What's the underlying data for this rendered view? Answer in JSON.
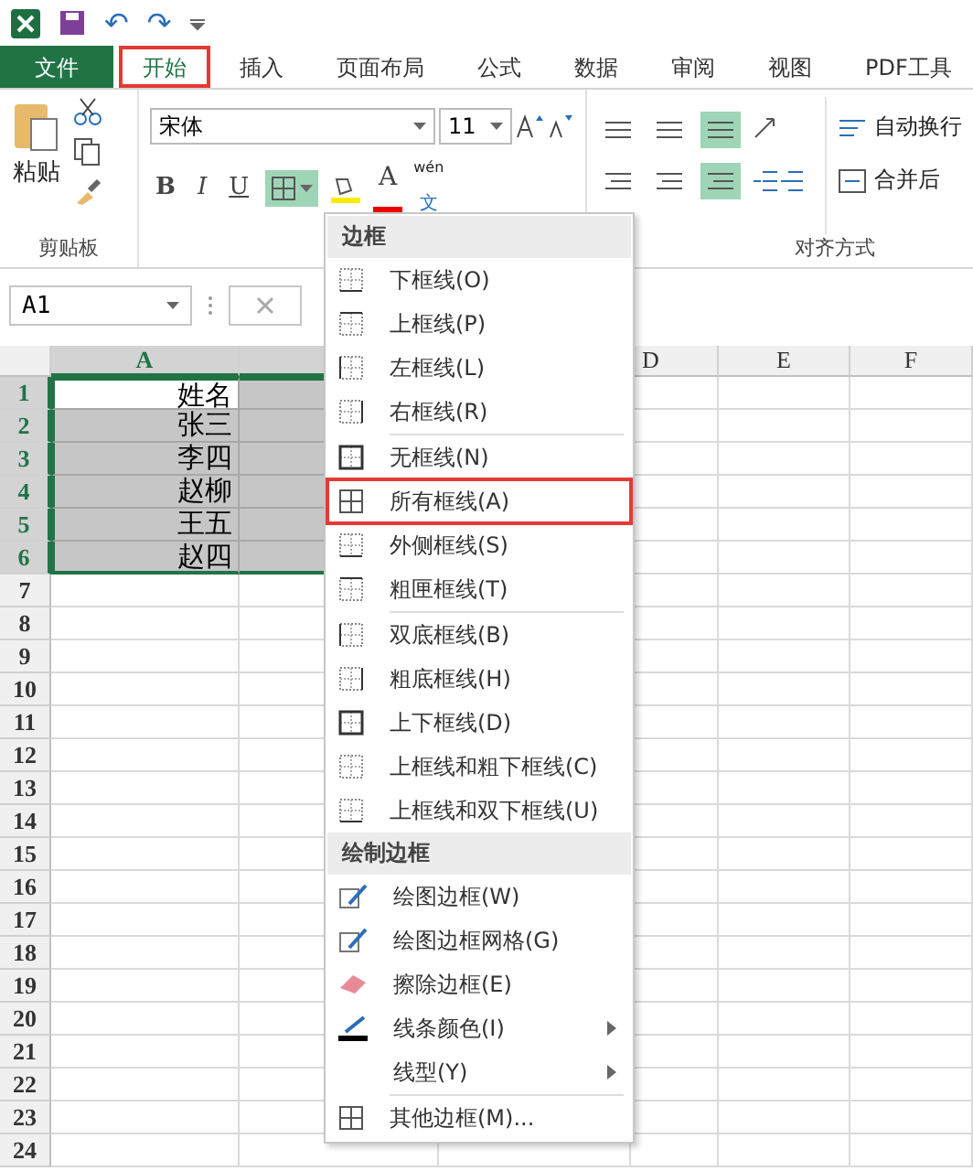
{
  "quick_access": {
    "undo": "↶",
    "redo": "↷"
  },
  "tabs": [
    {
      "label": "文件",
      "kind": "file",
      "selected": false,
      "highlighted": false
    },
    {
      "label": "开始",
      "kind": "tab",
      "selected": true,
      "highlighted": true
    },
    {
      "label": "插入",
      "kind": "tab",
      "selected": false,
      "highlighted": false
    },
    {
      "label": "页面布局",
      "kind": "tab",
      "selected": false,
      "highlighted": false
    },
    {
      "label": "公式",
      "kind": "tab",
      "selected": false,
      "highlighted": false
    },
    {
      "label": "数据",
      "kind": "tab",
      "selected": false,
      "highlighted": false
    },
    {
      "label": "审阅",
      "kind": "tab",
      "selected": false,
      "highlighted": false
    },
    {
      "label": "视图",
      "kind": "tab",
      "selected": false,
      "highlighted": false
    },
    {
      "label": "PDF工具",
      "kind": "tab",
      "selected": false,
      "highlighted": false
    }
  ],
  "ribbon": {
    "paste": "粘贴",
    "clipboard_group": "剪贴板",
    "font_name": "宋体",
    "font_size": "11",
    "bold": "B",
    "italic": "I",
    "underline": "U",
    "font_color_letter": "A",
    "phonetic_top": "wén",
    "phonetic_bottom": "文",
    "wrap_text": "自动换行",
    "merge": "合并后",
    "alignment_group": "对齐方式"
  },
  "formula_bar": {
    "name_box": "A1"
  },
  "sheet": {
    "columns": [
      {
        "label": "A",
        "selected": true
      },
      {
        "label": "D",
        "selected": false
      },
      {
        "label": "E",
        "selected": false
      },
      {
        "label": "F",
        "selected": false
      }
    ],
    "rows": [
      "1",
      "2",
      "3",
      "4",
      "5",
      "6",
      "7",
      "8",
      "9",
      "10",
      "11",
      "12",
      "13",
      "14",
      "15",
      "16",
      "17",
      "18",
      "19",
      "20",
      "21",
      "22",
      "23",
      "24"
    ],
    "cells": [
      {
        "text": "姓名",
        "active": true
      },
      {
        "text": "张三",
        "active": false
      },
      {
        "text": "李四",
        "active": false
      },
      {
        "text": "赵柳",
        "active": false
      },
      {
        "text": "王五",
        "active": false
      },
      {
        "text": "赵四",
        "active": false
      }
    ]
  },
  "border_menu": {
    "items": [
      {
        "kind": "header",
        "label": "边框"
      },
      {
        "kind": "item",
        "label": "下框线(O)",
        "highlighted": false
      },
      {
        "kind": "item",
        "label": "上框线(P)",
        "highlighted": false
      },
      {
        "kind": "item",
        "label": "左框线(L)",
        "highlighted": false
      },
      {
        "kind": "item",
        "label": "右框线(R)",
        "highlighted": false
      },
      {
        "kind": "divider"
      },
      {
        "kind": "item",
        "label": "无框线(N)",
        "highlighted": false
      },
      {
        "kind": "item",
        "label": "所有框线(A)",
        "highlighted": true
      },
      {
        "kind": "item",
        "label": "外侧框线(S)",
        "highlighted": false
      },
      {
        "kind": "item",
        "label": "粗匣框线(T)",
        "highlighted": false
      },
      {
        "kind": "divider"
      },
      {
        "kind": "item",
        "label": "双底框线(B)",
        "highlighted": false
      },
      {
        "kind": "item",
        "label": "粗底框线(H)",
        "highlighted": false
      },
      {
        "kind": "item",
        "label": "上下框线(D)",
        "highlighted": false
      },
      {
        "kind": "item",
        "label": "上框线和粗下框线(C)",
        "highlighted": false
      },
      {
        "kind": "item",
        "label": "上框线和双下框线(U)",
        "highlighted": false
      },
      {
        "kind": "header",
        "label": "绘制边框"
      },
      {
        "kind": "item",
        "label": "绘图边框(W)",
        "highlighted": false
      },
      {
        "kind": "item",
        "label": "绘图边框网格(G)",
        "highlighted": false
      },
      {
        "kind": "item",
        "label": "擦除边框(E)",
        "highlighted": false
      },
      {
        "kind": "submenu",
        "label": "线条颜色(I)",
        "highlighted": false
      },
      {
        "kind": "submenu",
        "label": "线型(Y)",
        "highlighted": false
      },
      {
        "kind": "divider"
      },
      {
        "kind": "item",
        "label": "其他边框(M)...",
        "highlighted": false
      }
    ]
  }
}
